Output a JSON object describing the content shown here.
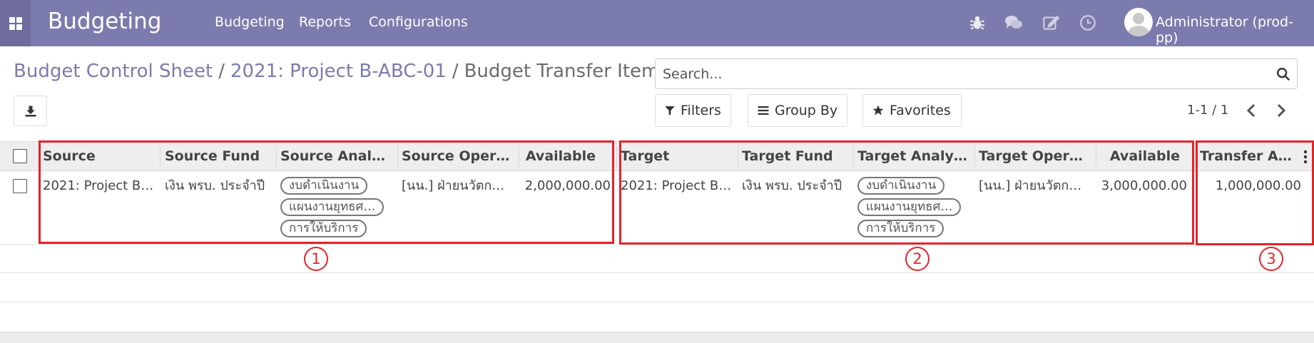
{
  "navbar": {
    "brand": "Budgeting",
    "menu": [
      "Budgeting",
      "Reports",
      "Configurations"
    ],
    "user": "Administrator (prod-pp)"
  },
  "breadcrumb": {
    "items": [
      "Budget Control Sheet",
      "2021: Project B-ABC-01"
    ],
    "current": "Budget Transfer Items"
  },
  "search": {
    "placeholder": "Search..."
  },
  "controls": {
    "filters": "Filters",
    "group_by": "Group By",
    "favorites": "Favorites",
    "pager": "1-1 / 1"
  },
  "table": {
    "headers": {
      "source": "Source",
      "source_fund": "Source Fund",
      "source_analytic": "Source Analyti…",
      "source_operating": "Source Operat…",
      "source_available": "Available",
      "target": "Target",
      "target_fund": "Target Fund",
      "target_analytic": "Target Analyti…",
      "target_operating": "Target Operati…",
      "target_available": "Available",
      "transfer_amount": "Transfer Am…"
    },
    "row": {
      "source": "2021: Project B-…",
      "source_fund": "เงิน พรบ. ประจำปี",
      "source_tags": [
        "งบดำเนินงาน",
        "แผนงานยุทธศ…",
        "การให้บริการ"
      ],
      "source_operating": "[นน.] ฝ่ายนวัตก…",
      "source_available": "2,000,000.00",
      "target": "2021: Project B…",
      "target_fund": "เงิน พรบ. ประจำปี",
      "target_tags": [
        "งบดำเนินงาน",
        "แผนงานยุทธศ…",
        "การให้บริการ"
      ],
      "target_operating": "[นน.] ฝ่ายนวัตก…",
      "target_available": "3,000,000.00",
      "transfer_amount": "1,000,000.00"
    }
  },
  "annotations": [
    "1",
    "2",
    "3"
  ],
  "colors": {
    "navbar": "#7c7bad",
    "link": "#7c7bad",
    "annotation": "#e3232b"
  }
}
